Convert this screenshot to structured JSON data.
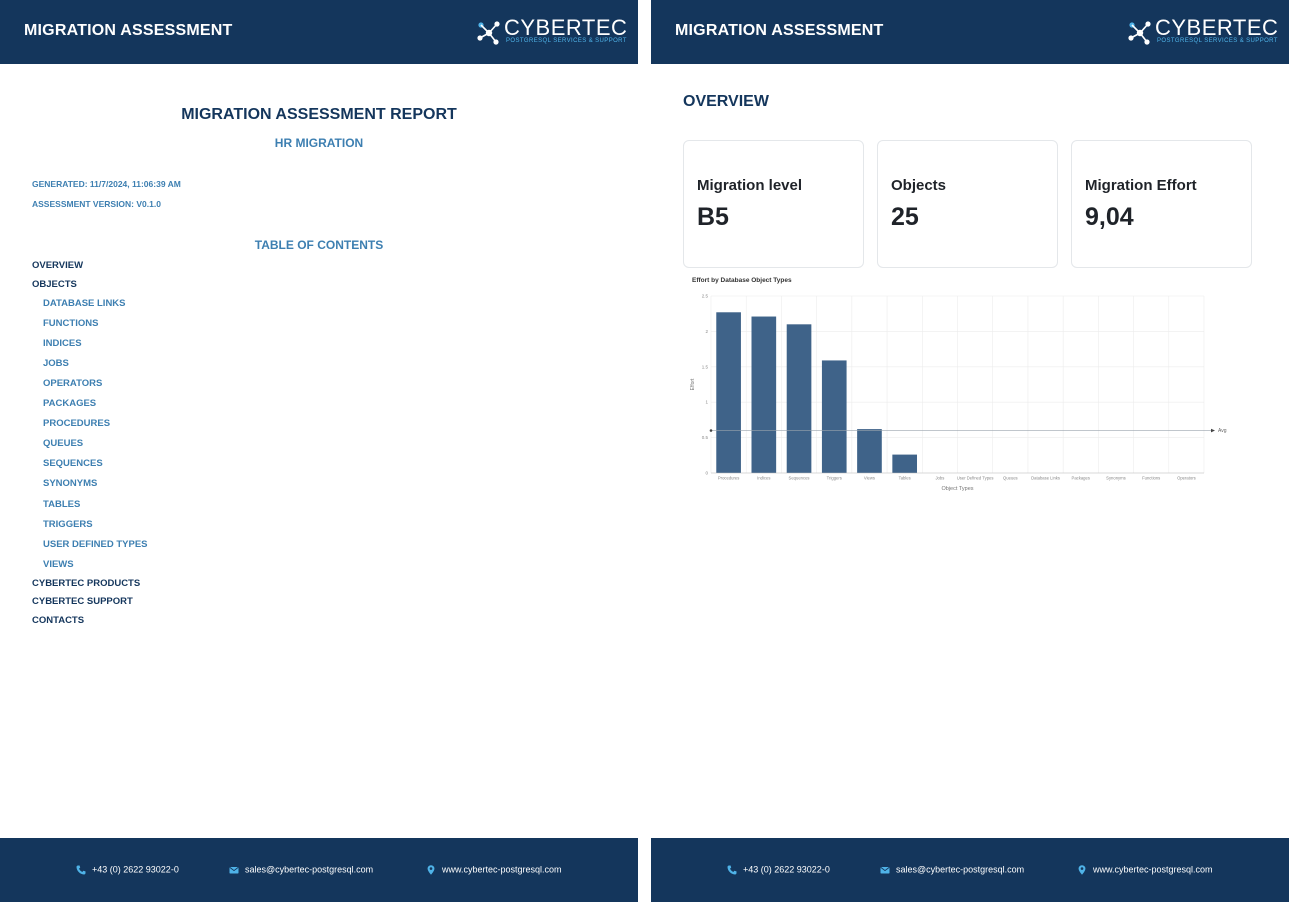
{
  "header": {
    "title": "MIGRATION ASSESSMENT",
    "logo_word": "CYBERTEC",
    "logo_sub": "POSTGRESQL SERVICES & SUPPORT"
  },
  "footer": {
    "phone": "+43 (0) 2622 93022-0",
    "email": "sales@cybertec-postgresql.com",
    "website": "www.cybertec-postgresql.com"
  },
  "report": {
    "title": "MIGRATION ASSESSMENT REPORT",
    "subtitle": "HR MIGRATION",
    "generated": "GENERATED: 11/7/2024, 11:06:39 AM",
    "version": "ASSESSMENT VERSION: V0.1.0"
  },
  "toc": {
    "title": "TABLE OF CONTENTS",
    "items": [
      {
        "label": "OVERVIEW",
        "level": 1
      },
      {
        "label": "OBJECTS",
        "level": 1
      },
      {
        "label": "DATABASE LINKS",
        "level": 2
      },
      {
        "label": "FUNCTIONS",
        "level": 2
      },
      {
        "label": "INDICES",
        "level": 2
      },
      {
        "label": "JOBS",
        "level": 2
      },
      {
        "label": "OPERATORS",
        "level": 2
      },
      {
        "label": "PACKAGES",
        "level": 2
      },
      {
        "label": "PROCEDURES",
        "level": 2
      },
      {
        "label": "QUEUES",
        "level": 2
      },
      {
        "label": "SEQUENCES",
        "level": 2
      },
      {
        "label": "SYNONYMS",
        "level": 2
      },
      {
        "label": "TABLES",
        "level": 2
      },
      {
        "label": "TRIGGERS",
        "level": 2
      },
      {
        "label": "USER DEFINED TYPES",
        "level": 2
      },
      {
        "label": "VIEWS",
        "level": 2
      },
      {
        "label": "CYBERTEC PRODUCTS",
        "level": 1
      },
      {
        "label": "CYBERTEC SUPPORT",
        "level": 1
      },
      {
        "label": "CONTACTS",
        "level": 1
      }
    ]
  },
  "overview": {
    "title": "OVERVIEW",
    "cards": [
      {
        "label": "Migration level",
        "value": "B5"
      },
      {
        "label": "Objects",
        "value": "25"
      },
      {
        "label": "Migration Effort",
        "value": "9,04"
      }
    ]
  },
  "colors": {
    "brand_navy": "#14365c",
    "accent_blue": "#3d7fb1",
    "logo_cyan": "#4fb3e8",
    "bar": "#3f6389"
  },
  "chart_data": {
    "type": "bar",
    "title": "Effort by Database Object Types",
    "xlabel": "Object Types",
    "ylabel": "Effort",
    "categories": [
      "Procedures",
      "Indices",
      "Sequences",
      "Triggers",
      "Views",
      "Tables",
      "Jobs",
      "User Defined Types",
      "Queues",
      "Database Links",
      "Packages",
      "Synonyms",
      "Functions",
      "Operators"
    ],
    "values": [
      2.27,
      2.21,
      2.1,
      1.59,
      0.62,
      0.26,
      0,
      0,
      0,
      0,
      0,
      0,
      0,
      0
    ],
    "ylim": [
      0,
      2.5
    ],
    "yticks": [
      0,
      0.5,
      1,
      1.5,
      2,
      2.5
    ],
    "ytick_labels": [
      "0",
      "0.5",
      "1",
      "1.5",
      "2",
      "2.5"
    ],
    "avg_line": {
      "value": 0.6,
      "label": "Avg"
    },
    "grid": true,
    "legend": "none"
  }
}
